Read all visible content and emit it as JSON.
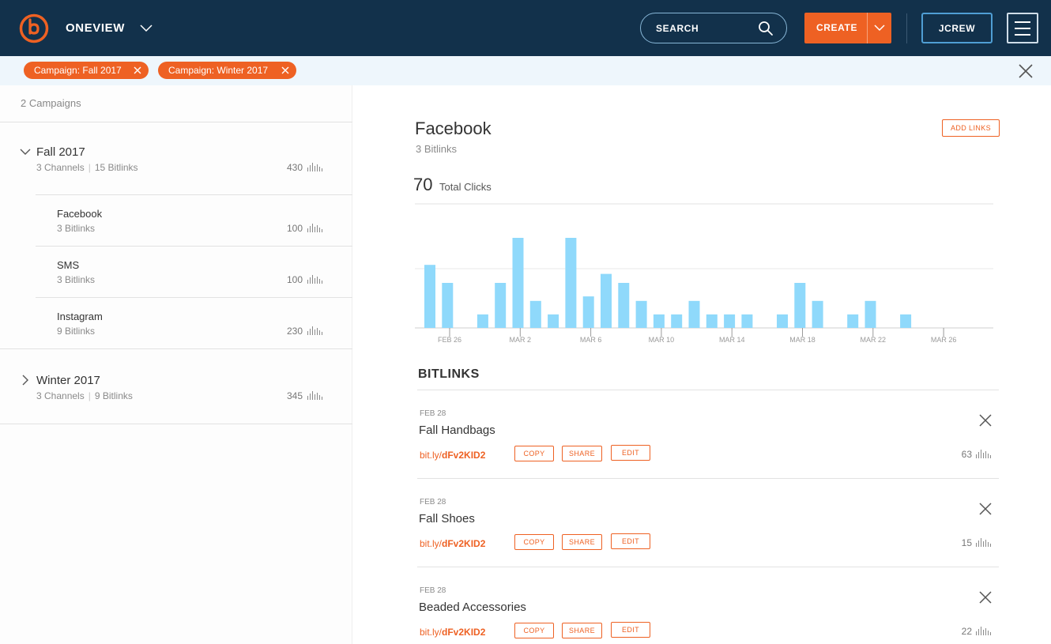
{
  "app": {
    "name": "ONEVIEW",
    "logo_icon": "bitly-logo-icon"
  },
  "header": {
    "search_label": "SEARCH",
    "create_label": "CREATE",
    "account_label": "JCREW"
  },
  "filters": [
    {
      "label": "Campaign: Fall 2017"
    },
    {
      "label": "Campaign: Winter 2017"
    }
  ],
  "sidebar": {
    "count_label": "2 Campaigns",
    "groups": [
      {
        "title": "Fall 2017",
        "channels": "3 Channels",
        "bitlinks": "15 Bitlinks",
        "clicks": "430",
        "expanded": true,
        "channels_list": [
          {
            "title": "Facebook",
            "meta": "3 Bitlinks",
            "clicks": "100"
          },
          {
            "title": "SMS",
            "meta": "3 Bitlinks",
            "clicks": "100"
          },
          {
            "title": "Instagram",
            "meta": "9 Bitlinks",
            "clicks": "230"
          }
        ]
      },
      {
        "title": "Winter 2017",
        "channels": "3 Channels",
        "bitlinks": "9 Bitlinks",
        "clicks": "345",
        "expanded": false
      }
    ]
  },
  "main": {
    "title": "Facebook",
    "subtitle": "3 Bitlinks",
    "add_links_label": "ADD LINKS",
    "total_clicks": "70",
    "total_clicks_label": "Total Clicks",
    "bitlinks_heading": "BITLINKS",
    "buttons": {
      "copy": "COPY",
      "share": "SHARE",
      "edit": "EDIT"
    },
    "bitlinks": [
      {
        "date": "FEB 28",
        "title": "Fall Handbags",
        "domain": "bit.ly/",
        "hash": "dFv2KID2",
        "clicks": "63"
      },
      {
        "date": "FEB 28",
        "title": "Fall Shoes",
        "domain": "bit.ly/",
        "hash": "dFv2KID2",
        "clicks": "15"
      },
      {
        "date": "FEB 28",
        "title": "Beaded Accessories",
        "domain": "bit.ly/",
        "hash": "dFv2KID2",
        "clicks": "22"
      }
    ]
  },
  "chart_data": {
    "type": "bar",
    "tick_labels": [
      "FEB 26",
      "MAR 2",
      "MAR 6",
      "MAR 10",
      "MAR 14",
      "MAR 18",
      "MAR 22",
      "MAR 26"
    ],
    "values": [
      7,
      5,
      0,
      1.5,
      5,
      10,
      3,
      1.5,
      10,
      3.5,
      6,
      5,
      3,
      1.5,
      1.5,
      3,
      1.5,
      1.5,
      1.5,
      0,
      1.5,
      5,
      3,
      0,
      1.5,
      3,
      0,
      1.5
    ],
    "ylim": [
      0,
      10
    ],
    "grid": true,
    "color": "#8fd9fb"
  },
  "colors": {
    "accent": "#ee6123",
    "navy": "#12314b",
    "filter_bg": "#eef6fc"
  }
}
